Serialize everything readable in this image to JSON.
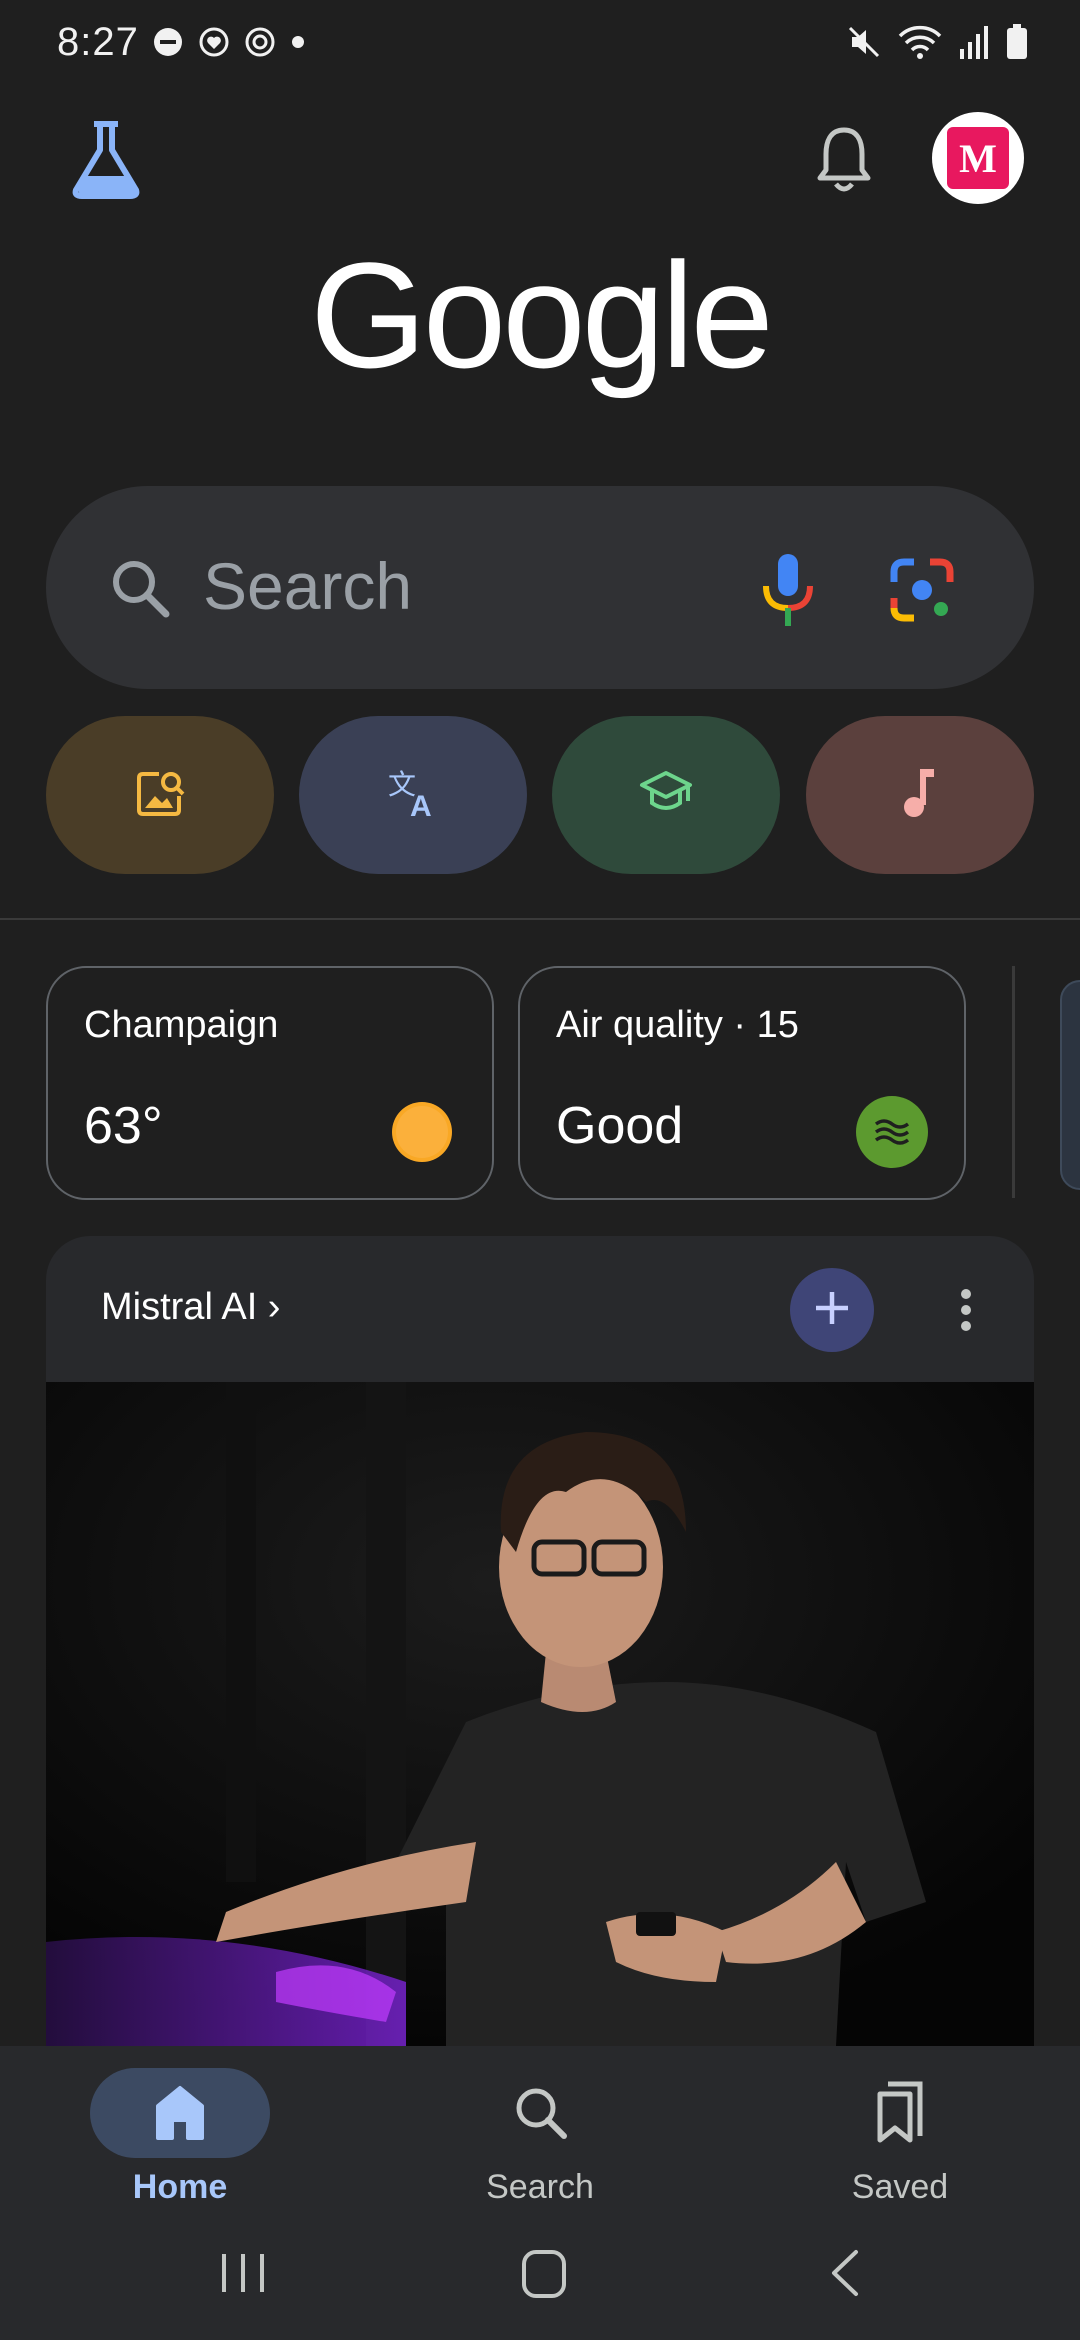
{
  "status_bar": {
    "time": "8:27",
    "left_icons": [
      "do-not-disturb-icon",
      "heart-badge-icon",
      "sync-icon",
      "dot-icon"
    ],
    "right_icons": [
      "mute-icon",
      "wifi-icon",
      "signal-icon",
      "battery-icon"
    ]
  },
  "top_bar": {
    "labs_icon": "flask-icon",
    "bell_icon": "bell-icon",
    "avatar_letter": "M"
  },
  "logo": {
    "text": "Google"
  },
  "search": {
    "placeholder": "Search",
    "icons": [
      "search-icon",
      "mic-icon",
      "lens-icon"
    ]
  },
  "shortcuts": [
    {
      "icon": "image-search-icon",
      "color": "#4a3d27"
    },
    {
      "icon": "translate-icon",
      "color": "#3a4055"
    },
    {
      "icon": "school-icon",
      "color": "#2f4a3b"
    },
    {
      "icon": "music-note-icon",
      "color": "#5b403d"
    }
  ],
  "cards": {
    "weather": {
      "location": "Champaign",
      "temperature": "63°",
      "icon": "sun-icon"
    },
    "air_quality": {
      "title": "Air quality · 15",
      "status": "Good",
      "icon": "air-waves-icon"
    }
  },
  "feed": {
    "topic": "Mistral AI ›",
    "add_icon": "plus-icon",
    "more_icon": "more-vert-icon"
  },
  "bottom_nav": {
    "items": [
      {
        "label": "Home",
        "icon": "home-icon",
        "active": true
      },
      {
        "label": "Search",
        "icon": "search-icon",
        "active": false
      },
      {
        "label": "Saved",
        "icon": "bookmarks-icon",
        "active": false
      }
    ]
  },
  "system_nav": [
    "recents-button",
    "home-button",
    "back-button"
  ],
  "colors": {
    "background": "#1f1f1f",
    "search_box": "#303134",
    "active_nav": "#a8c7fa",
    "air_quality_good": "#5c9a2f",
    "sun": "#f9a825"
  }
}
